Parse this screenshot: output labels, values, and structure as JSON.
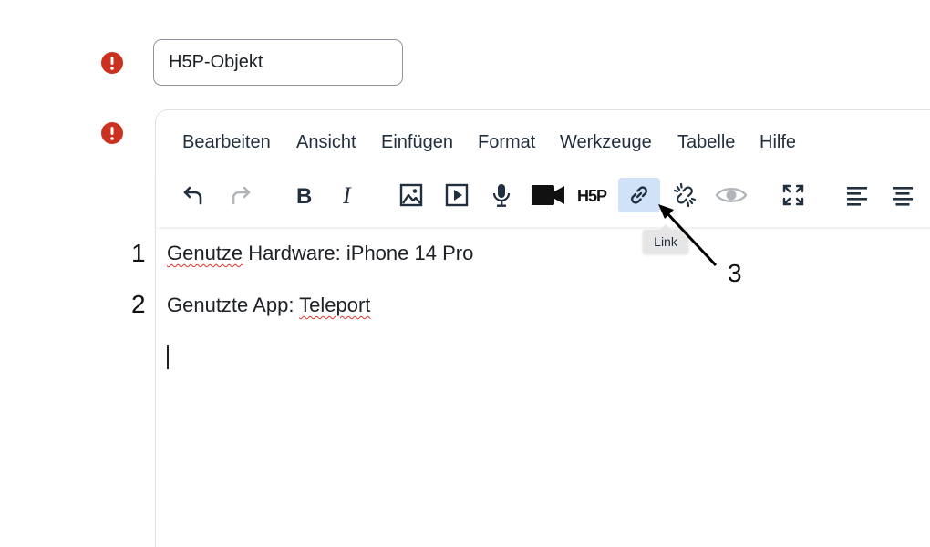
{
  "form": {
    "title_value": "H5P-Objekt"
  },
  "menubar": {
    "items": [
      "Bearbeiten",
      "Ansicht",
      "Einfügen",
      "Format",
      "Werkzeuge",
      "Tabelle",
      "Hilfe"
    ]
  },
  "toolbar": {
    "buttons": [
      {
        "icon": "undo-icon"
      },
      {
        "icon": "redo-icon",
        "state": "disabled"
      },
      {
        "icon": "bold-icon"
      },
      {
        "icon": "italic-icon"
      },
      {
        "icon": "image-icon"
      },
      {
        "icon": "media-icon"
      },
      {
        "icon": "microphone-icon"
      },
      {
        "icon": "video-camera-icon"
      },
      {
        "icon": "h5p-icon",
        "text": "H5P"
      },
      {
        "icon": "link-icon",
        "state": "active"
      },
      {
        "icon": "unlink-icon"
      },
      {
        "icon": "preview-eye-icon"
      },
      {
        "icon": "fullscreen-icon"
      },
      {
        "icon": "align-left-icon"
      },
      {
        "icon": "align-center-icon"
      }
    ],
    "tooltip": "Link"
  },
  "content": {
    "line1_word1": "Genutze",
    "line1_rest": " Hardware: iPhone 14 Pro",
    "line2_start": "Genutzte App: ",
    "line2_word": "Teleport"
  },
  "annotations": {
    "n1": "1",
    "n2": "2",
    "n3": "3"
  },
  "colors": {
    "error": "#ca3120",
    "active_button": "#cfe2f7",
    "spellcheck": "#e03131"
  }
}
